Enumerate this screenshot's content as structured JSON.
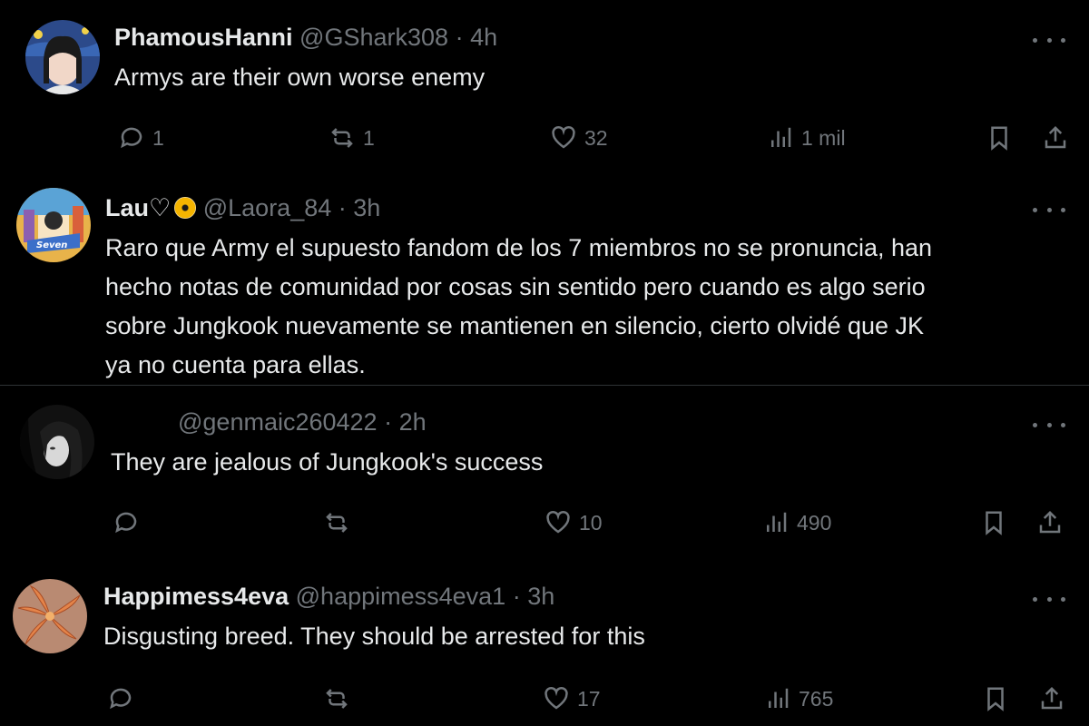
{
  "posts": [
    {
      "name": "PhamousHanni",
      "handle": "@GShark308",
      "separator": "·",
      "time": "4h",
      "text_lines": [
        "Armys are their own worse enemy"
      ],
      "replies": "1",
      "reposts": "1",
      "likes": "32",
      "views": "1 mil"
    },
    {
      "name": "Lau♡",
      "handle": "@Laora_84",
      "separator": "·",
      "time": "3h",
      "text_lines": [
        "Raro que Army el supuesto fandom de los 7 miembros no se pronuncia, han",
        "hecho notas de comunidad por cosas sin sentido pero cuando es algo serio",
        "sobre Jungkook nuevamente se mantienen en silencio, cierto olvidé que JK",
        "ya no cuenta para ellas."
      ]
    },
    {
      "name": "",
      "handle": "@genmaic260422",
      "separator": "·",
      "time": "2h",
      "text_lines": [
        "They are jealous of Jungkook's success"
      ],
      "replies": "",
      "reposts": "",
      "likes": "10",
      "views": "490"
    },
    {
      "name": "Happimess4eva",
      "handle": "@happimess4eva1",
      "separator": "·",
      "time": "3h",
      "text_lines": [
        "Disgusting breed. They should be arrested for this"
      ],
      "replies": "",
      "reposts": "",
      "likes": "17",
      "views": "765"
    }
  ],
  "icons": {
    "reply": "reply-icon",
    "repost": "repost-icon",
    "like": "heart-icon",
    "views": "views-icon",
    "bookmark": "bookmark-icon",
    "share": "share-icon",
    "more": "more-icon",
    "badge": "verified-org-badge-icon"
  },
  "colors": {
    "background": "#000000",
    "primary_text": "#e7e9ea",
    "secondary_text": "#71767b",
    "divider": "#2f3336"
  }
}
